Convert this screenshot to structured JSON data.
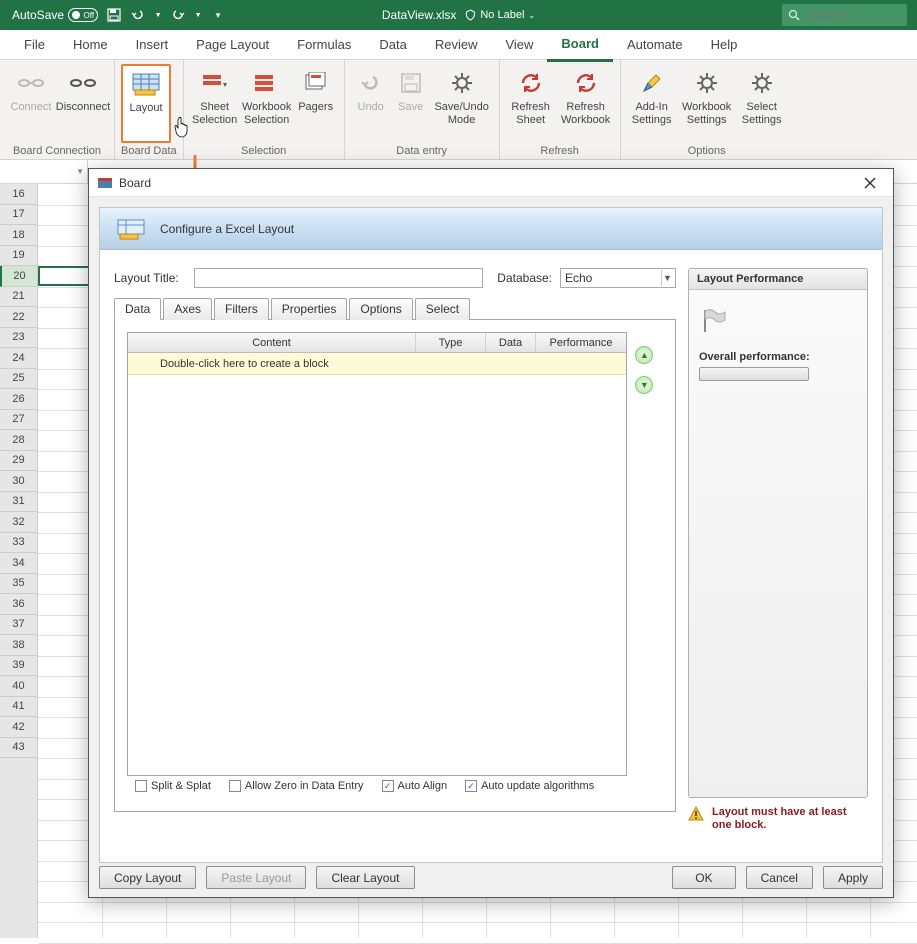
{
  "titlebar": {
    "autosave_label": "AutoSave",
    "autosave_state": "Off",
    "filename": "DataView.xlsx",
    "nolabel": "No Label",
    "search_placeholder": "Search"
  },
  "menu": {
    "tabs": [
      "File",
      "Home",
      "Insert",
      "Page Layout",
      "Formulas",
      "Data",
      "Review",
      "View",
      "Board",
      "Automate",
      "Help"
    ],
    "active": "Board"
  },
  "ribbon": {
    "groups": [
      {
        "label": "Board Connection",
        "items": [
          {
            "name": "connect",
            "label": "Connect",
            "disabled": true
          },
          {
            "name": "disconnect",
            "label": "Disconnect",
            "disabled": false
          }
        ]
      },
      {
        "label": "Board Data",
        "items": [
          {
            "name": "layout",
            "label": "Layout",
            "highlighted": true
          }
        ]
      },
      {
        "label": "Selection",
        "items": [
          {
            "name": "sheet-selection",
            "label": "Sheet Selection"
          },
          {
            "name": "workbook-selection",
            "label": "Workbook Selection"
          },
          {
            "name": "pagers",
            "label": "Pagers"
          }
        ]
      },
      {
        "label": "Data entry",
        "items": [
          {
            "name": "undo",
            "label": "Undo",
            "disabled": true
          },
          {
            "name": "save",
            "label": "Save",
            "disabled": true
          },
          {
            "name": "saveundo-mode",
            "label": "Save/Undo Mode"
          }
        ]
      },
      {
        "label": "Refresh",
        "items": [
          {
            "name": "refresh-sheet",
            "label": "Refresh Sheet"
          },
          {
            "name": "refresh-workbook",
            "label": "Refresh Workbook"
          }
        ]
      },
      {
        "label": "Options",
        "items": [
          {
            "name": "addin-settings",
            "label": "Add-In Settings"
          },
          {
            "name": "workbook-settings",
            "label": "Workbook Settings"
          },
          {
            "name": "select-settings",
            "label": "Select Settings"
          }
        ]
      }
    ]
  },
  "rows": {
    "start": 16,
    "end": 43,
    "selected": 20
  },
  "dialog": {
    "title": "Board",
    "header": "Configure a Excel Layout",
    "layout_title_label": "Layout Title:",
    "layout_title_value": "",
    "database_label": "Database:",
    "database_value": "Echo",
    "tabs": [
      "Data",
      "Axes",
      "Filters",
      "Properties",
      "Options",
      "Select"
    ],
    "active_tab": "Data",
    "table_headers": {
      "content": "Content",
      "type": "Type",
      "data": "Data",
      "performance": "Performance"
    },
    "hint": "Double-click here to create a block",
    "checkboxes": {
      "split_splat": {
        "label": "Split & Splat",
        "checked": false
      },
      "allow_zero": {
        "label": "Allow Zero in Data Entry",
        "checked": false
      },
      "auto_align": {
        "label": "Auto Align",
        "checked": true
      },
      "auto_update": {
        "label": "Auto update algorithms",
        "checked": true
      }
    },
    "perf_panel": {
      "title": "Layout Performance",
      "overall_label": "Overall performance:",
      "warning": "Layout must have at least one block."
    },
    "buttons": {
      "copy": "Copy Layout",
      "paste": "Paste Layout",
      "clear": "Clear Layout",
      "ok": "OK",
      "cancel": "Cancel",
      "apply": "Apply"
    }
  }
}
